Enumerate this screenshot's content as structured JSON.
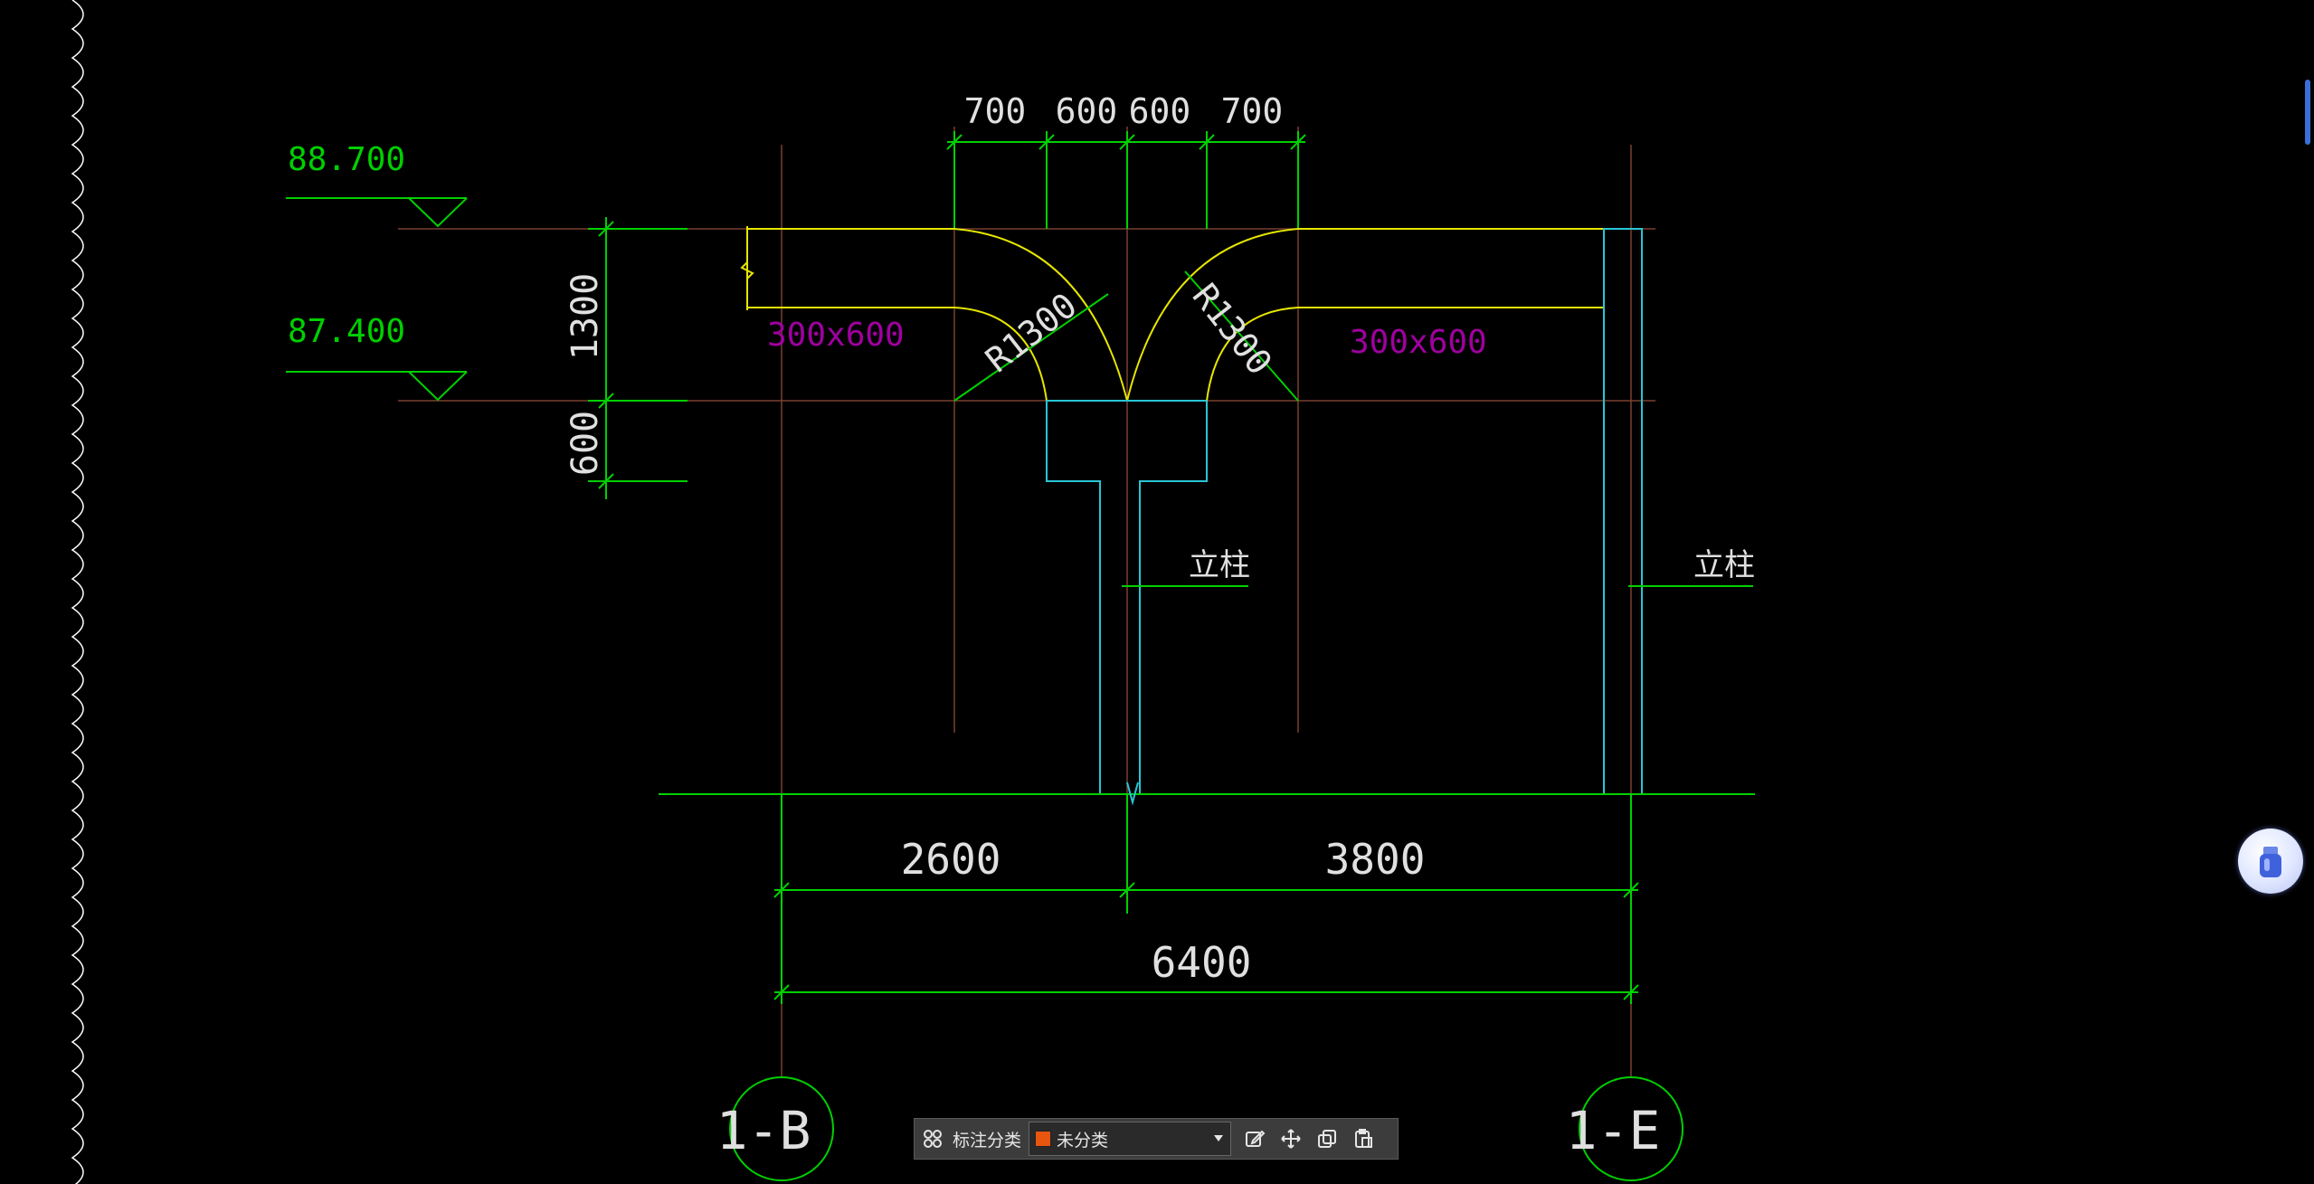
{
  "elevations": [
    {
      "label": "88.700"
    },
    {
      "label": "87.400"
    }
  ],
  "dimensions": {
    "top": [
      "700",
      "600",
      "600",
      "700"
    ],
    "left_vertical": [
      "1300",
      "600"
    ],
    "bottom_row1": [
      "2600",
      "3800"
    ],
    "bottom_row2": "6400"
  },
  "beam_labels": [
    "300x600",
    "300x600"
  ],
  "radius_labels": [
    "R1300",
    "R1300"
  ],
  "column_labels": [
    "立柱",
    "立柱"
  ],
  "axis_bubbles": [
    "1-B",
    "1-E"
  ],
  "toolbar": {
    "grid_icon": "grid-icon",
    "label": "标注分类",
    "select_value": "未分类",
    "select_color": "#e8550f",
    "actions": [
      {
        "name": "edit-icon"
      },
      {
        "name": "move-icon"
      },
      {
        "name": "copy-icon"
      },
      {
        "name": "paste-icon"
      }
    ]
  },
  "colors": {
    "green": "#00d000",
    "yellow": "#e6e600",
    "cyan": "#29c6d6",
    "magenta": "#a000a0",
    "white": "#e0e0e0",
    "brown": "#7a4030"
  }
}
